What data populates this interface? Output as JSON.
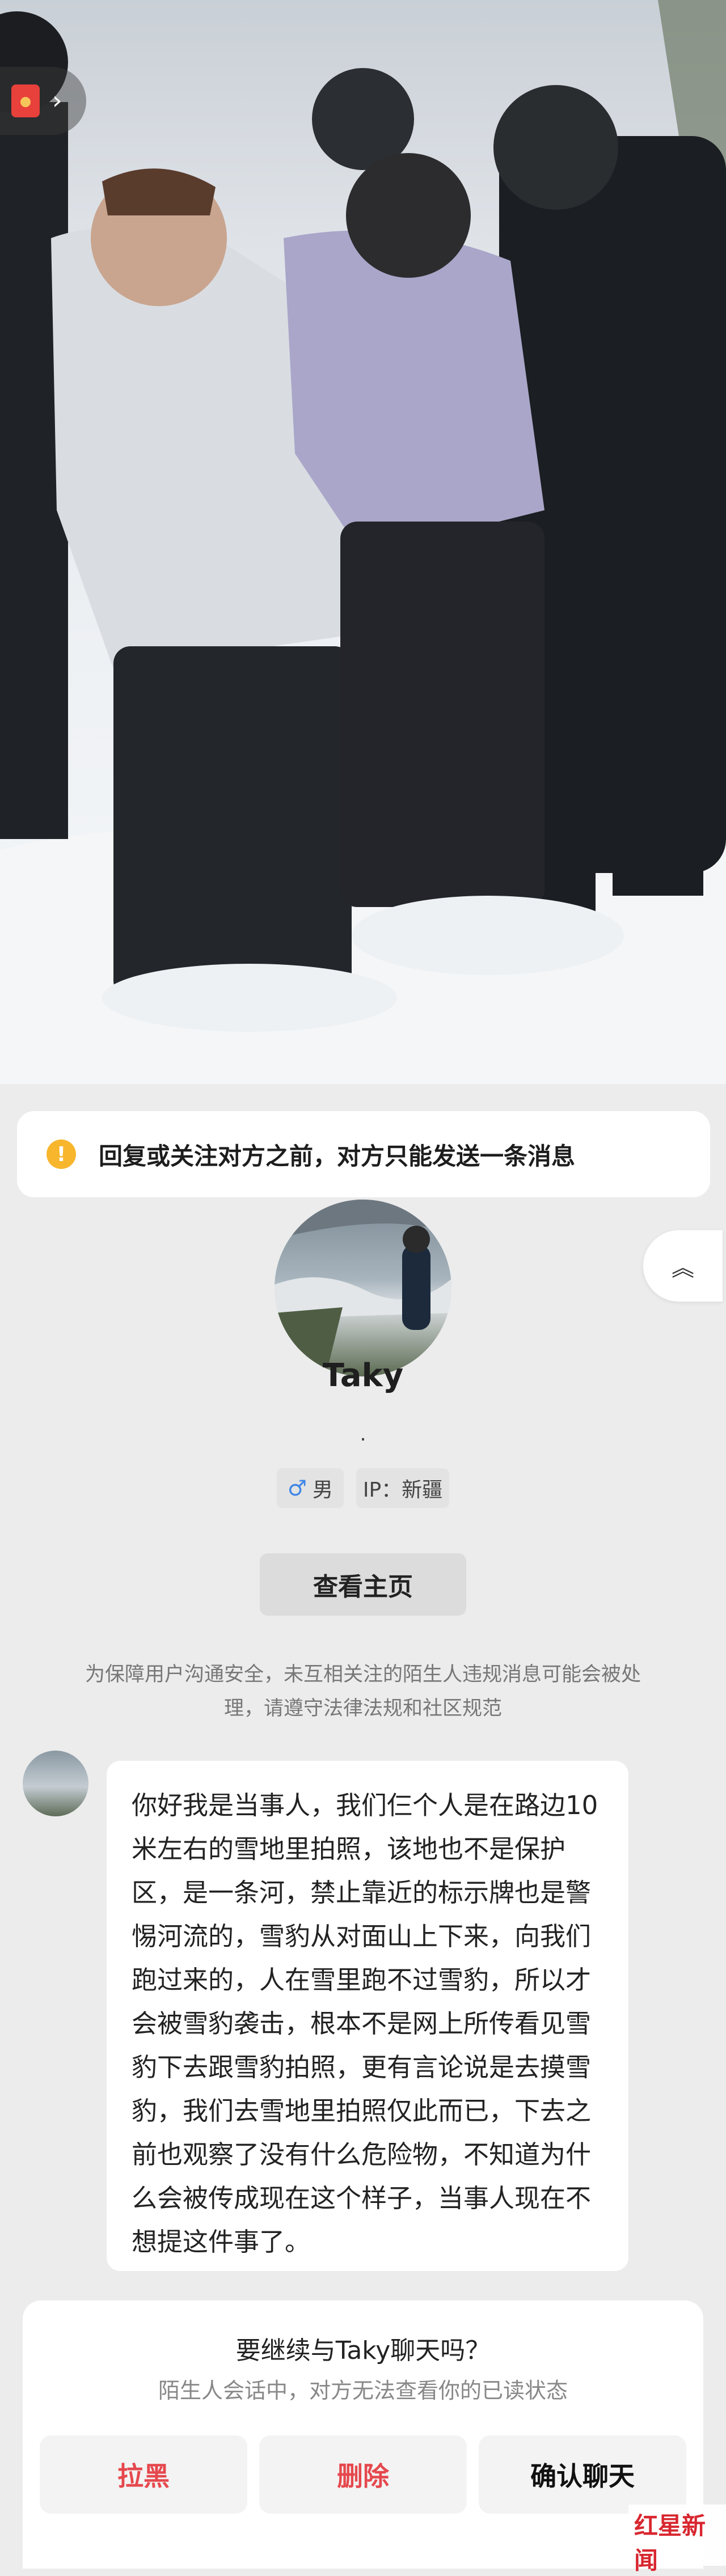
{
  "notice": {
    "text": "回复或关注对方之前，对方只能发送一条消息"
  },
  "profile": {
    "username": "Taky",
    "signature": ".",
    "gender_symbol": "♂",
    "gender": "男",
    "ip_location": "IP：新疆",
    "view_homepage": "查看主页"
  },
  "safety_notice": "为保障用户沟通安全，未互相关注的陌生人违规消息可能会被处理，请遵守法律法规和社区规范",
  "message": {
    "text": "你好我是当事人，我们仨个人是在路边10米左右的雪地里拍照，该地也不是保护区，是一条河，禁止靠近的标示牌也是警惕河流的，雪豹从对面山上下来，向我们跑过来的，人在雪里跑不过雪豹，所以才会被雪豹袭击，根本不是网上所传看见雪豹下去跟雪豹拍照，更有言论说是去摸雪豹，我们去雪地里拍照仅此而已，下去之前也观察了没有什么危险物，不知道为什么会被传成现在这个样子，当事人现在不想提这件事了。"
  },
  "sheet": {
    "title": "要继续与Taky聊天吗？",
    "subtitle": "陌生人会话中，对方无法查看你的已读状态",
    "block_label": "拉黑",
    "delete_label": "删除",
    "confirm_label": "确认聊天"
  },
  "watermark": {
    "main": "红星新闻"
  },
  "icons": {
    "warning": "warning-icon",
    "collapse": "chevron-up-double-icon",
    "red_packet": "red-packet-icon",
    "male": "male-icon"
  },
  "colors": {
    "warning": "#f8b62d",
    "danger": "#e5484d",
    "male": "#3f86e6",
    "brand_red": "#d8262f"
  }
}
